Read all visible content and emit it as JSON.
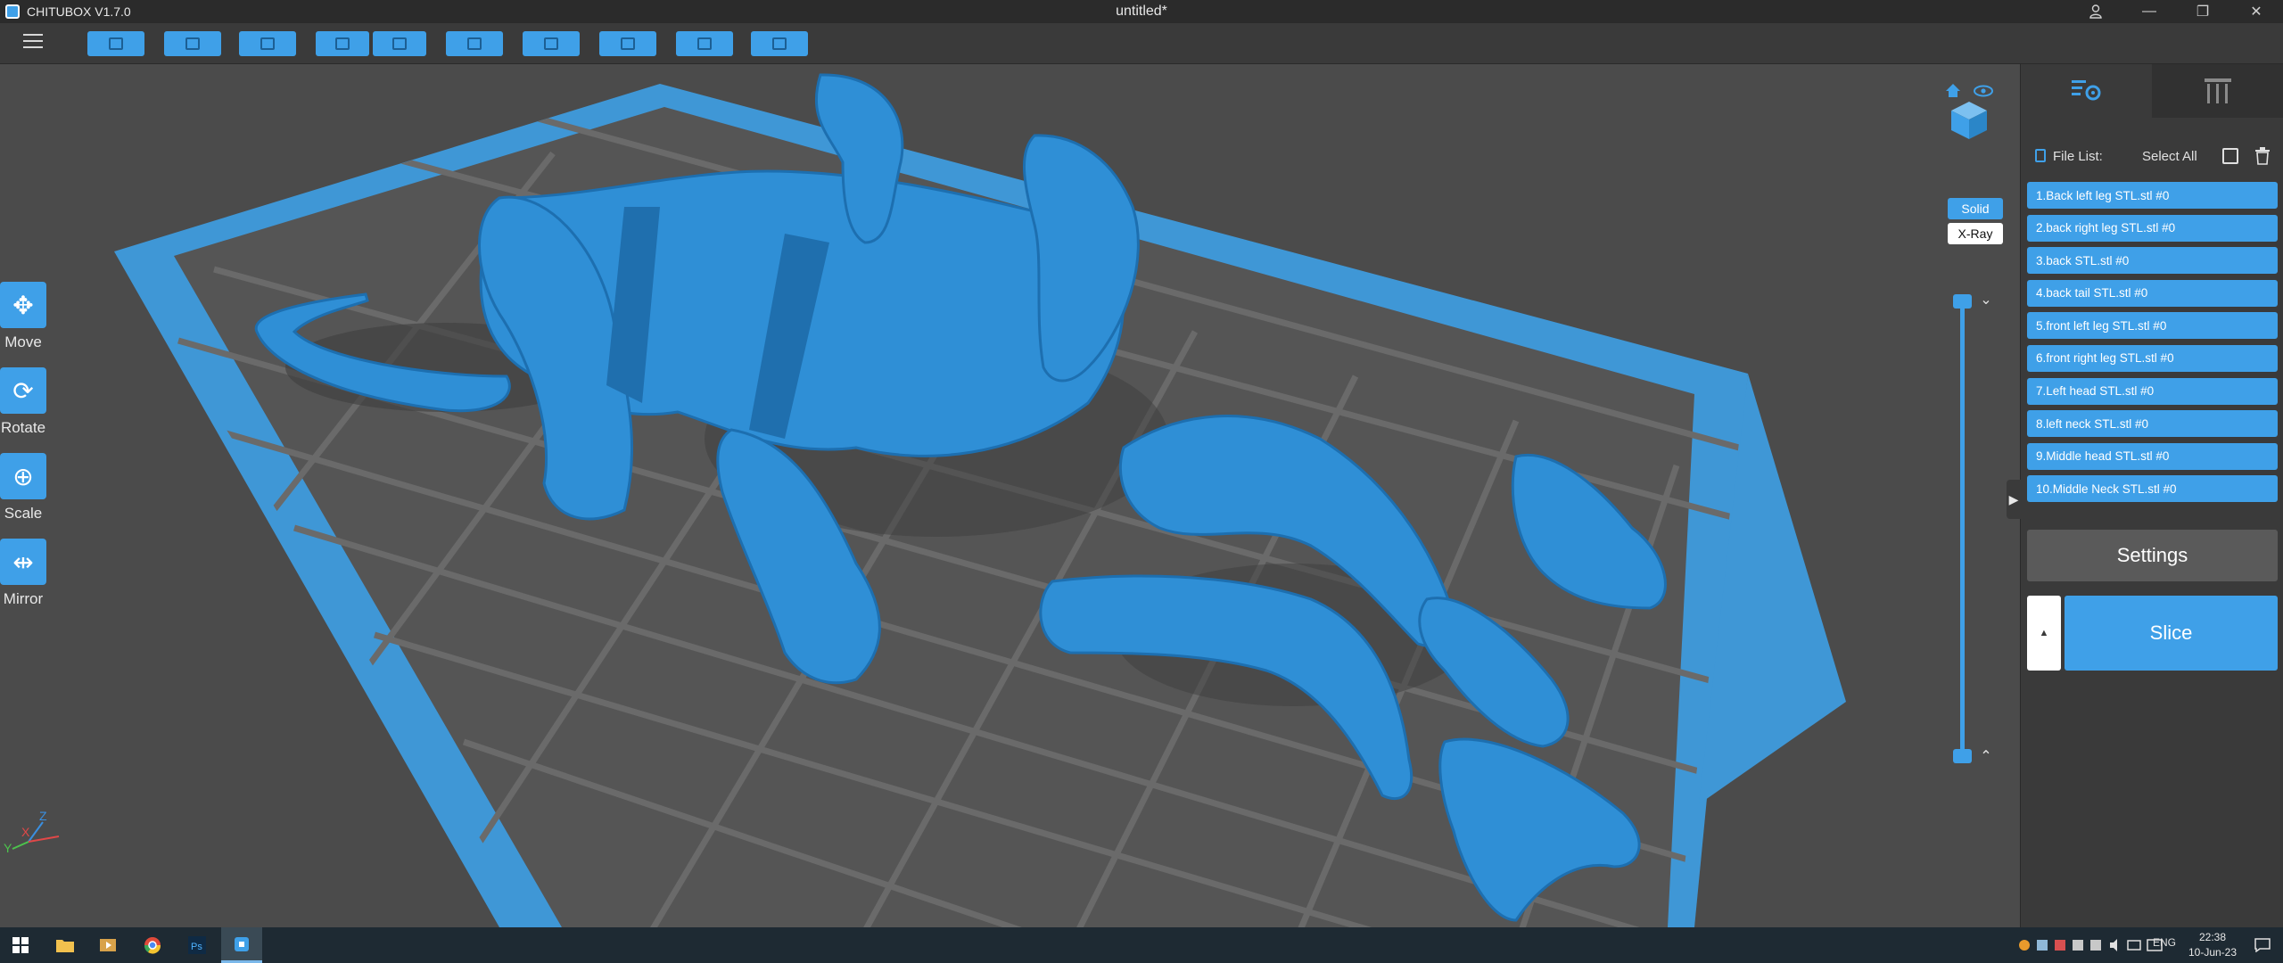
{
  "app": {
    "name": "CHITUBOX V1.7.0",
    "window_title": "untitled*"
  },
  "window_controls": {
    "account_icon": "user-icon",
    "minimize": "—",
    "restore": "❐",
    "close": "✕"
  },
  "toolbar": {
    "buttons": [
      "open-icon",
      "save-icon",
      "select-icon",
      "undo-icon",
      "redo-icon",
      "layers-icon",
      "supports-icon",
      "hollow-icon",
      "dig-hole-icon",
      "arrange-icon"
    ]
  },
  "tools": [
    {
      "label": "Move",
      "icon": "move-icon"
    },
    {
      "label": "Rotate",
      "icon": "rotate-icon"
    },
    {
      "label": "Scale",
      "icon": "scale-icon"
    },
    {
      "label": "Mirror",
      "icon": "mirror-icon"
    }
  ],
  "render_mode": {
    "solid": "Solid",
    "xray": "X-Ray",
    "selected": "Solid"
  },
  "axis": {
    "x": "X",
    "y": "Y",
    "z": "Z"
  },
  "right_panel": {
    "file_list_label": "File List:",
    "select_all_label": "Select All",
    "files": [
      "1.Back left leg STL.stl #0",
      "2.back right leg STL.stl #0",
      "3.back STL.stl #0",
      "4.back tail STL.stl #0",
      "5.front left leg STL.stl #0",
      "6.front right leg STL.stl #0",
      "7.Left head STL.stl #0",
      "8.left neck STL.stl #0",
      "9.Middle head STL.stl #0",
      "10.Middle Neck STL.stl #0"
    ],
    "settings_label": "Settings",
    "slice_label": "Slice",
    "slice_arrow": "▲"
  },
  "taskbar": {
    "language": "ENG",
    "time": "22:38",
    "date": "10-Jun-23"
  },
  "colors": {
    "accent": "#3fa0e8",
    "model": "#2f8fd6",
    "background": "#4b4b4b"
  }
}
